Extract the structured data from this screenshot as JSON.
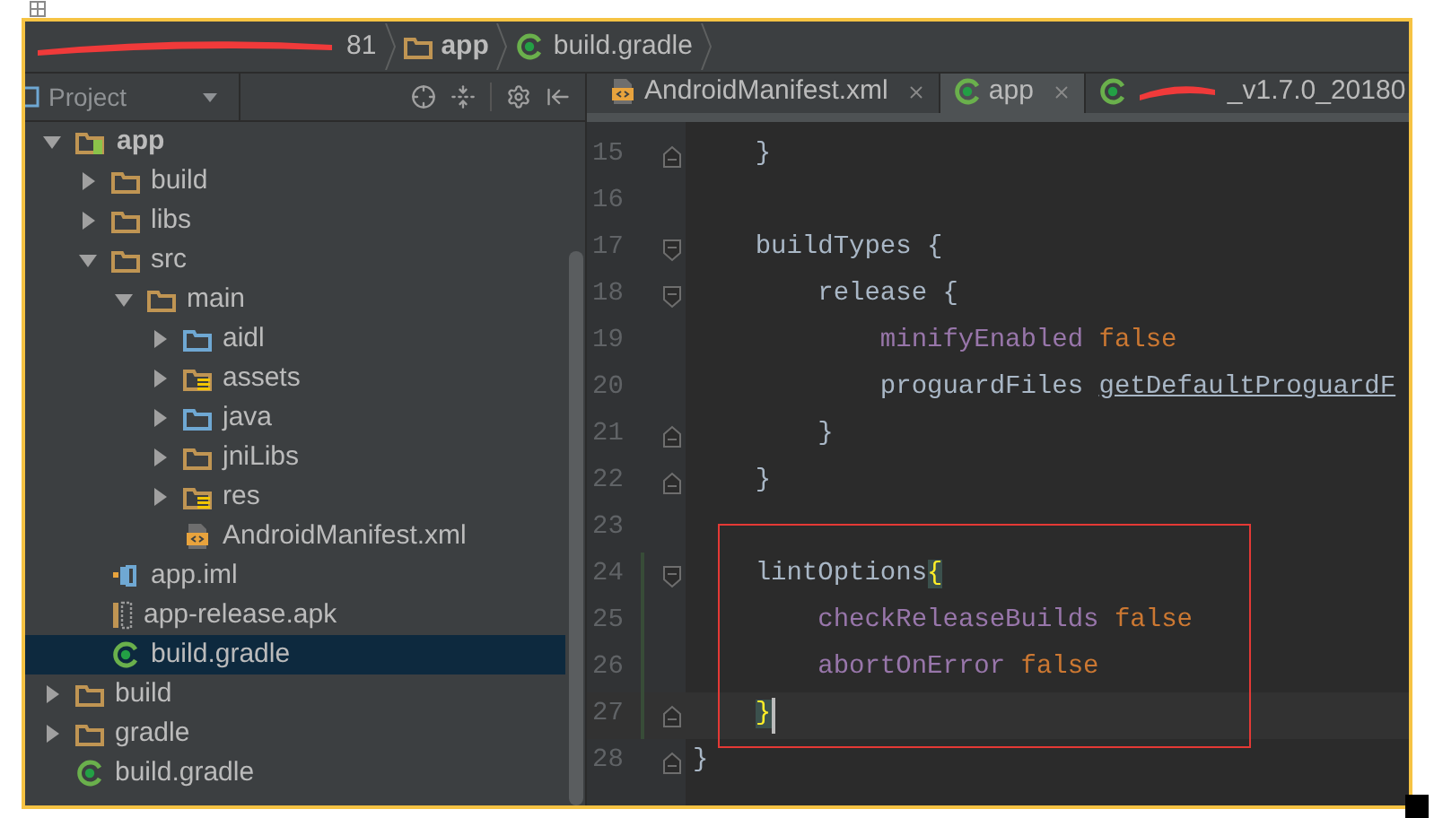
{
  "breadcrumb": [
    {
      "text": "81",
      "kind": "redacted"
    },
    {
      "text": "app",
      "kind": "module"
    },
    {
      "text": "build.gradle",
      "kind": "gradle"
    }
  ],
  "project_panel": {
    "title": "Project",
    "tree": [
      {
        "label": "app",
        "kind": "module",
        "expanded": true,
        "selected": false,
        "children": [
          {
            "label": "build",
            "kind": "folder",
            "expanded": false,
            "selected": false
          },
          {
            "label": "libs",
            "kind": "folder",
            "expanded": false,
            "selected": false
          },
          {
            "label": "src",
            "kind": "folder",
            "expanded": true,
            "selected": false,
            "children": [
              {
                "label": "main",
                "kind": "folder",
                "expanded": true,
                "selected": false,
                "children": [
                  {
                    "label": "aidl",
                    "kind": "source",
                    "expanded": false,
                    "selected": false
                  },
                  {
                    "label": "assets",
                    "kind": "resources",
                    "expanded": false,
                    "selected": false
                  },
                  {
                    "label": "java",
                    "kind": "source",
                    "expanded": false,
                    "selected": false
                  },
                  {
                    "label": "jniLibs",
                    "kind": "folder",
                    "expanded": false,
                    "selected": false
                  },
                  {
                    "label": "res",
                    "kind": "resources",
                    "expanded": false,
                    "selected": false
                  },
                  {
                    "label": "AndroidManifest.xml",
                    "kind": "xml",
                    "selected": false
                  }
                ]
              }
            ]
          },
          {
            "label": "app.iml",
            "kind": "iml",
            "selected": false
          },
          {
            "label": "app-release.apk",
            "kind": "apk",
            "selected": false
          },
          {
            "label": "build.gradle",
            "kind": "gradle",
            "selected": true
          }
        ]
      },
      {
        "label": "build",
        "kind": "folder",
        "expanded": false,
        "selected": false
      },
      {
        "label": "gradle",
        "kind": "folder",
        "expanded": false,
        "selected": false
      },
      {
        "label": "build.gradle",
        "kind": "gradle",
        "selected": false
      }
    ]
  },
  "editor_tabs": [
    {
      "label": "AndroidManifest.xml",
      "kind": "xml",
      "selected": false,
      "redacted": false
    },
    {
      "label": "app",
      "kind": "gradle",
      "selected": true,
      "redacted": false
    },
    {
      "label": "_v1.7.0_20180",
      "kind": "gradle",
      "selected": false,
      "redacted": true
    }
  ],
  "code_lines": [
    {
      "number": "15",
      "fold_open": false,
      "fold_close": true,
      "changed": false,
      "current": false,
      "tokens": [
        {
          "text": "    }",
          "kind": "plain"
        }
      ]
    },
    {
      "number": "16",
      "fold_open": false,
      "fold_close": false,
      "changed": false,
      "current": false
    },
    {
      "number": "17",
      "fold_open": true,
      "fold_close": false,
      "changed": false,
      "current": false,
      "tokens": [
        {
          "text": "    buildTypes {",
          "kind": "plain"
        }
      ]
    },
    {
      "number": "18",
      "fold_open": true,
      "fold_close": false,
      "changed": false,
      "current": false,
      "tokens": [
        {
          "text": "        release {",
          "kind": "plain"
        }
      ]
    },
    {
      "number": "19",
      "fold_open": false,
      "fold_close": false,
      "changed": false,
      "current": false,
      "tokens": [
        {
          "text": "            minifyEnabled",
          "kind": "property"
        },
        {
          "text": " false",
          "kind": "keyword"
        }
      ]
    },
    {
      "number": "20",
      "fold_open": false,
      "fold_close": false,
      "changed": false,
      "current": false,
      "tokens": [
        {
          "text": "            proguardFiles",
          "kind": "plain"
        },
        {
          "text": " getDefaultProguardF",
          "kind": "call"
        }
      ]
    },
    {
      "number": "21",
      "fold_open": false,
      "fold_close": true,
      "changed": false,
      "current": false,
      "tokens": [
        {
          "text": "        }",
          "kind": "plain"
        }
      ]
    },
    {
      "number": "22",
      "fold_open": false,
      "fold_close": true,
      "changed": false,
      "current": false,
      "tokens": [
        {
          "text": "    }",
          "kind": "plain"
        }
      ]
    },
    {
      "number": "23",
      "fold_open": false,
      "fold_close": false,
      "changed": false,
      "current": false
    },
    {
      "number": "24",
      "fold_open": true,
      "fold_close": false,
      "changed": true,
      "current": false,
      "tokens": [
        {
          "text": "    lintOptions",
          "kind": "plain"
        },
        {
          "text": "{",
          "kind": "brace_match"
        }
      ]
    },
    {
      "number": "25",
      "fold_open": false,
      "fold_close": false,
      "changed": true,
      "current": false,
      "tokens": [
        {
          "text": "        checkReleaseBuilds",
          "kind": "property"
        },
        {
          "text": " false",
          "kind": "keyword"
        }
      ]
    },
    {
      "number": "26",
      "fold_open": false,
      "fold_close": false,
      "changed": true,
      "current": false,
      "tokens": [
        {
          "text": "        abortOnError",
          "kind": "property"
        },
        {
          "text": " false",
          "kind": "keyword"
        }
      ]
    },
    {
      "number": "27",
      "fold_open": false,
      "fold_close": true,
      "changed": true,
      "current": true,
      "tokens": [
        {
          "text": "    }",
          "kind": "brace_match"
        }
      ]
    },
    {
      "number": "28",
      "fold_open": false,
      "fold_close": true,
      "changed": false,
      "current": false,
      "tokens": [
        {
          "text": "}",
          "kind": "plain"
        }
      ]
    }
  ]
}
